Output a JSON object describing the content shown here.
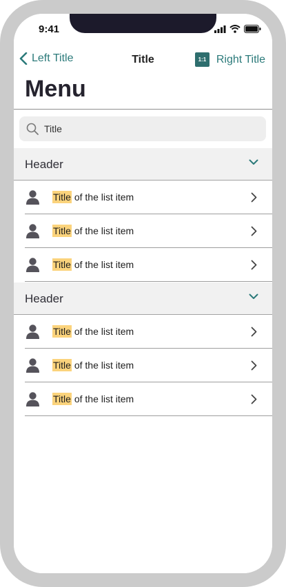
{
  "status_bar": {
    "time": "9:41"
  },
  "nav": {
    "back_label": "Left Title",
    "title": "Title",
    "right_icon_text": "1:1",
    "right_label": "Right Title"
  },
  "page_title": "Menu",
  "search": {
    "value": "Title"
  },
  "sections": [
    {
      "header": "Header",
      "items": [
        {
          "highlight": "Title",
          "rest": " of the list item"
        },
        {
          "highlight": "Title",
          "rest": " of the list item"
        },
        {
          "highlight": "Title",
          "rest": " of the list item"
        }
      ]
    },
    {
      "header": "Header",
      "items": [
        {
          "highlight": "Title",
          "rest": " of the list item"
        },
        {
          "highlight": "Title",
          "rest": " of the list item"
        },
        {
          "highlight": "Title",
          "rest": " of the list item"
        }
      ]
    }
  ],
  "colors": {
    "accent": "#2b7a7a",
    "highlight": "#fbd37c",
    "frame": "#cbcbcb"
  }
}
